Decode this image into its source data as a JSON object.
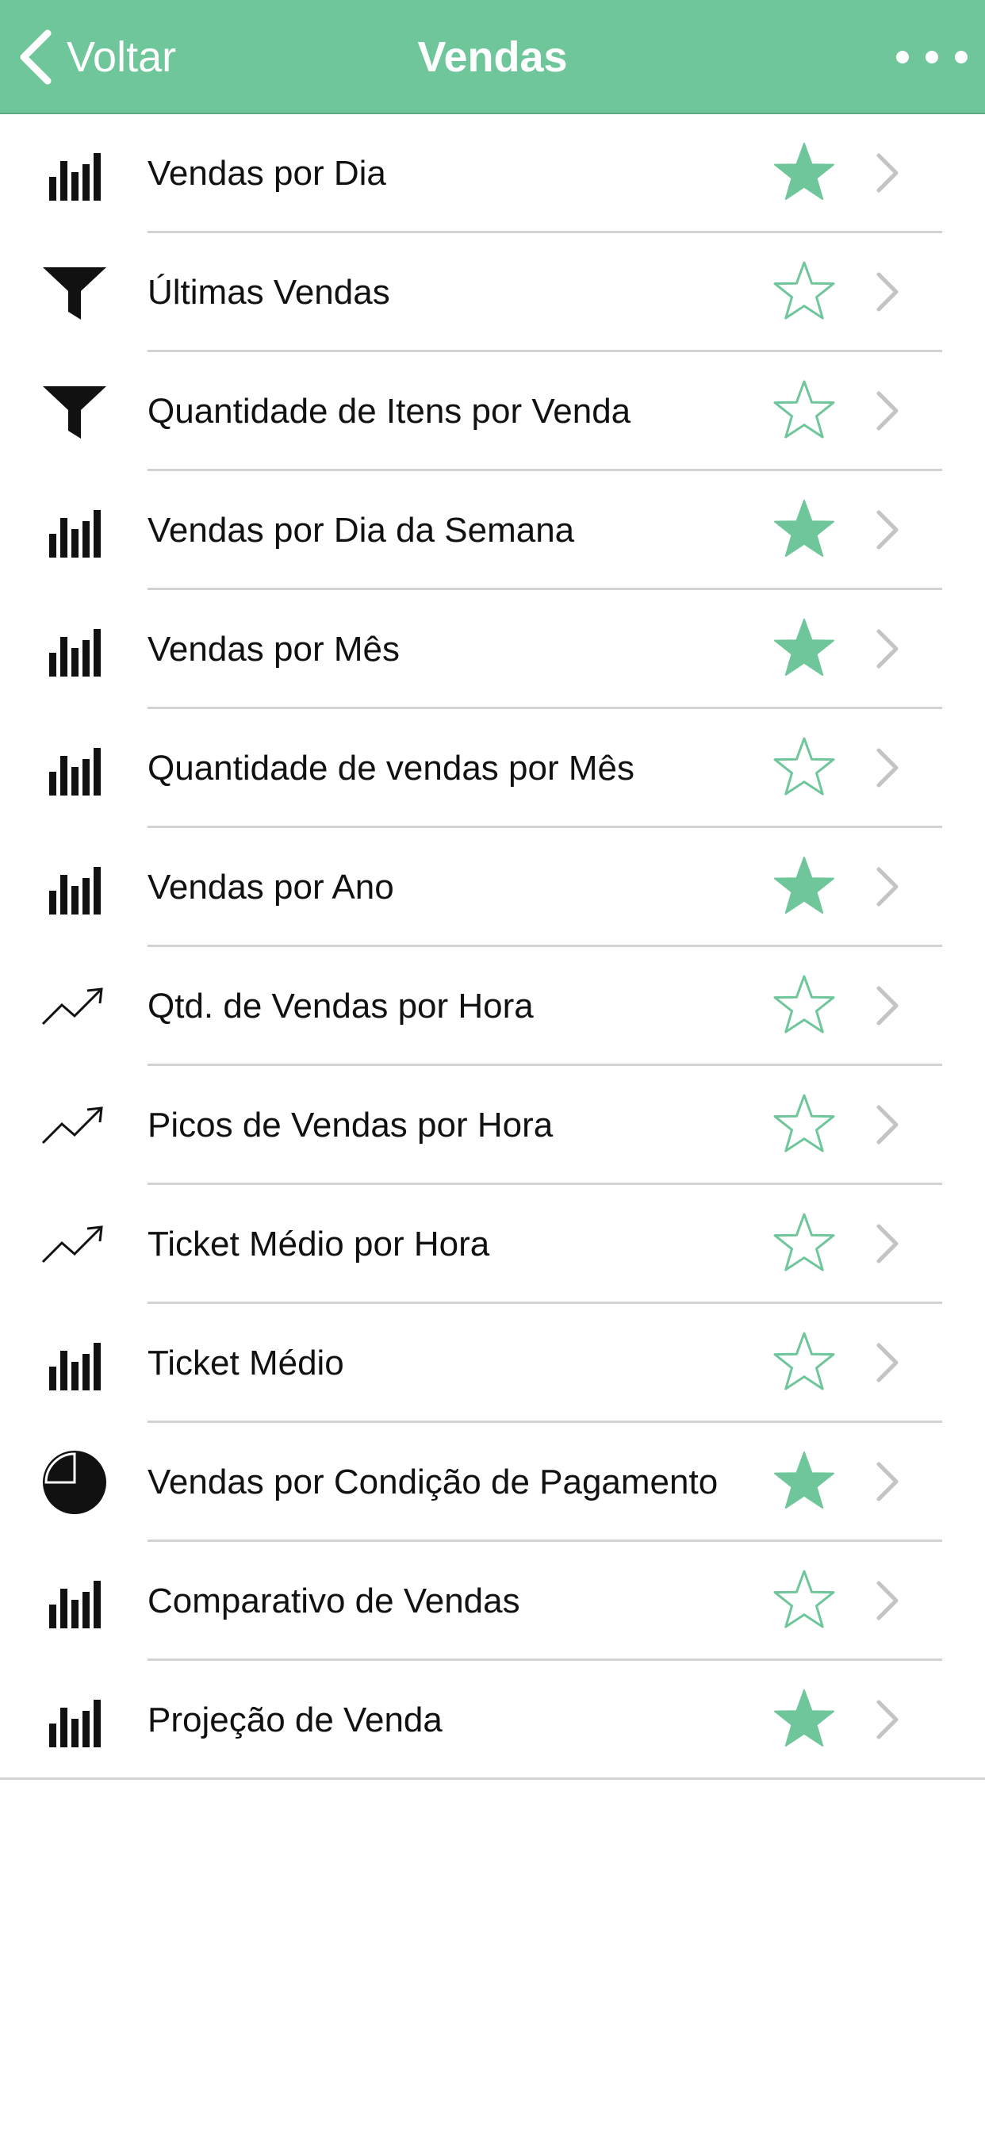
{
  "header": {
    "back_label": "Voltar",
    "title": "Vendas",
    "background_color": "#6fc69a"
  },
  "colors": {
    "accent": "#6fc69a",
    "icon": "#111111",
    "divider": "#d3d3d3",
    "chevron": "#c4c4c4"
  },
  "items": [
    {
      "label": "Vendas por Dia",
      "icon": "bar-chart-icon",
      "favorite": true
    },
    {
      "label": "Últimas Vendas",
      "icon": "funnel-icon",
      "favorite": false
    },
    {
      "label": "Quantidade de Itens por Venda",
      "icon": "funnel-icon",
      "favorite": false
    },
    {
      "label": "Vendas por Dia da Semana",
      "icon": "bar-chart-icon",
      "favorite": true
    },
    {
      "label": "Vendas por Mês",
      "icon": "bar-chart-icon",
      "favorite": true
    },
    {
      "label": "Quantidade de vendas por Mês",
      "icon": "bar-chart-icon",
      "favorite": false
    },
    {
      "label": "Vendas por Ano",
      "icon": "bar-chart-icon",
      "favorite": true
    },
    {
      "label": "Qtd. de Vendas por Hora",
      "icon": "trend-line-icon",
      "favorite": false
    },
    {
      "label": "Picos de Vendas por Hora",
      "icon": "trend-line-icon",
      "favorite": false
    },
    {
      "label": "Ticket Médio por Hora",
      "icon": "trend-line-icon",
      "favorite": false
    },
    {
      "label": "Ticket Médio",
      "icon": "bar-chart-icon",
      "favorite": false
    },
    {
      "label": "Vendas por Condição de Pagamento",
      "icon": "pie-chart-icon",
      "favorite": true
    },
    {
      "label": "Comparativo de Vendas",
      "icon": "bar-chart-icon",
      "favorite": false
    },
    {
      "label": "Projeção de Venda",
      "icon": "bar-chart-icon",
      "favorite": true
    }
  ]
}
